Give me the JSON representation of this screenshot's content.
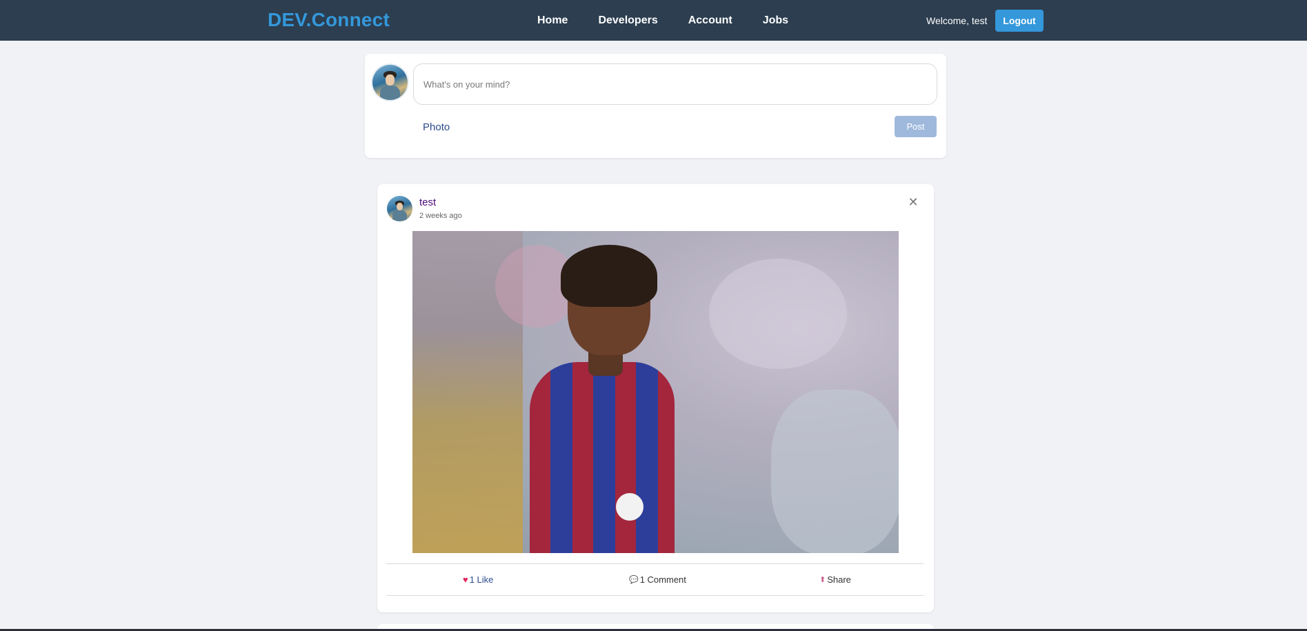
{
  "navbar": {
    "brand": "DEV.Connect",
    "links": [
      "Home",
      "Developers",
      "Account",
      "Jobs"
    ],
    "welcome": "Welcome, test",
    "logout_label": "Logout"
  },
  "composer": {
    "placeholder": "What's on your mind?",
    "photo_label": "Photo",
    "post_label": "Post"
  },
  "post": {
    "author": "test",
    "time": "2 weeks ago",
    "close_glyph": "✕",
    "likes_label": "1 Like",
    "comments_label": "1 Comment",
    "share_label": "Share",
    "icons": {
      "like": "heart-icon",
      "comment": "comment-icon",
      "share": "share-icon"
    }
  },
  "colors": {
    "navbar": "#2c3e50",
    "brand": "#3498db",
    "logout": "#3498db",
    "post_button_disabled": "#9fb9dc",
    "author": "#4b0a75",
    "like": "#e0245e"
  }
}
